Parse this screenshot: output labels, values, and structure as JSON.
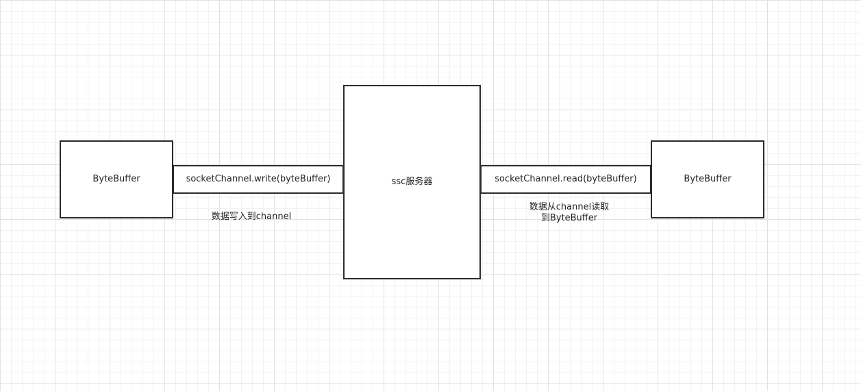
{
  "diagram": {
    "left_buffer": {
      "label": "ByteBuffer"
    },
    "write_channel": {
      "label": "socketChannel.write(byteBuffer)"
    },
    "server": {
      "label": "ssc服务器"
    },
    "read_channel": {
      "label": "socketChannel.read(byteBuffer)"
    },
    "right_buffer": {
      "label": "ByteBuffer"
    },
    "write_caption": "数据写入到channel",
    "read_caption": "数据从channel读取\n到ByteBuffer"
  }
}
